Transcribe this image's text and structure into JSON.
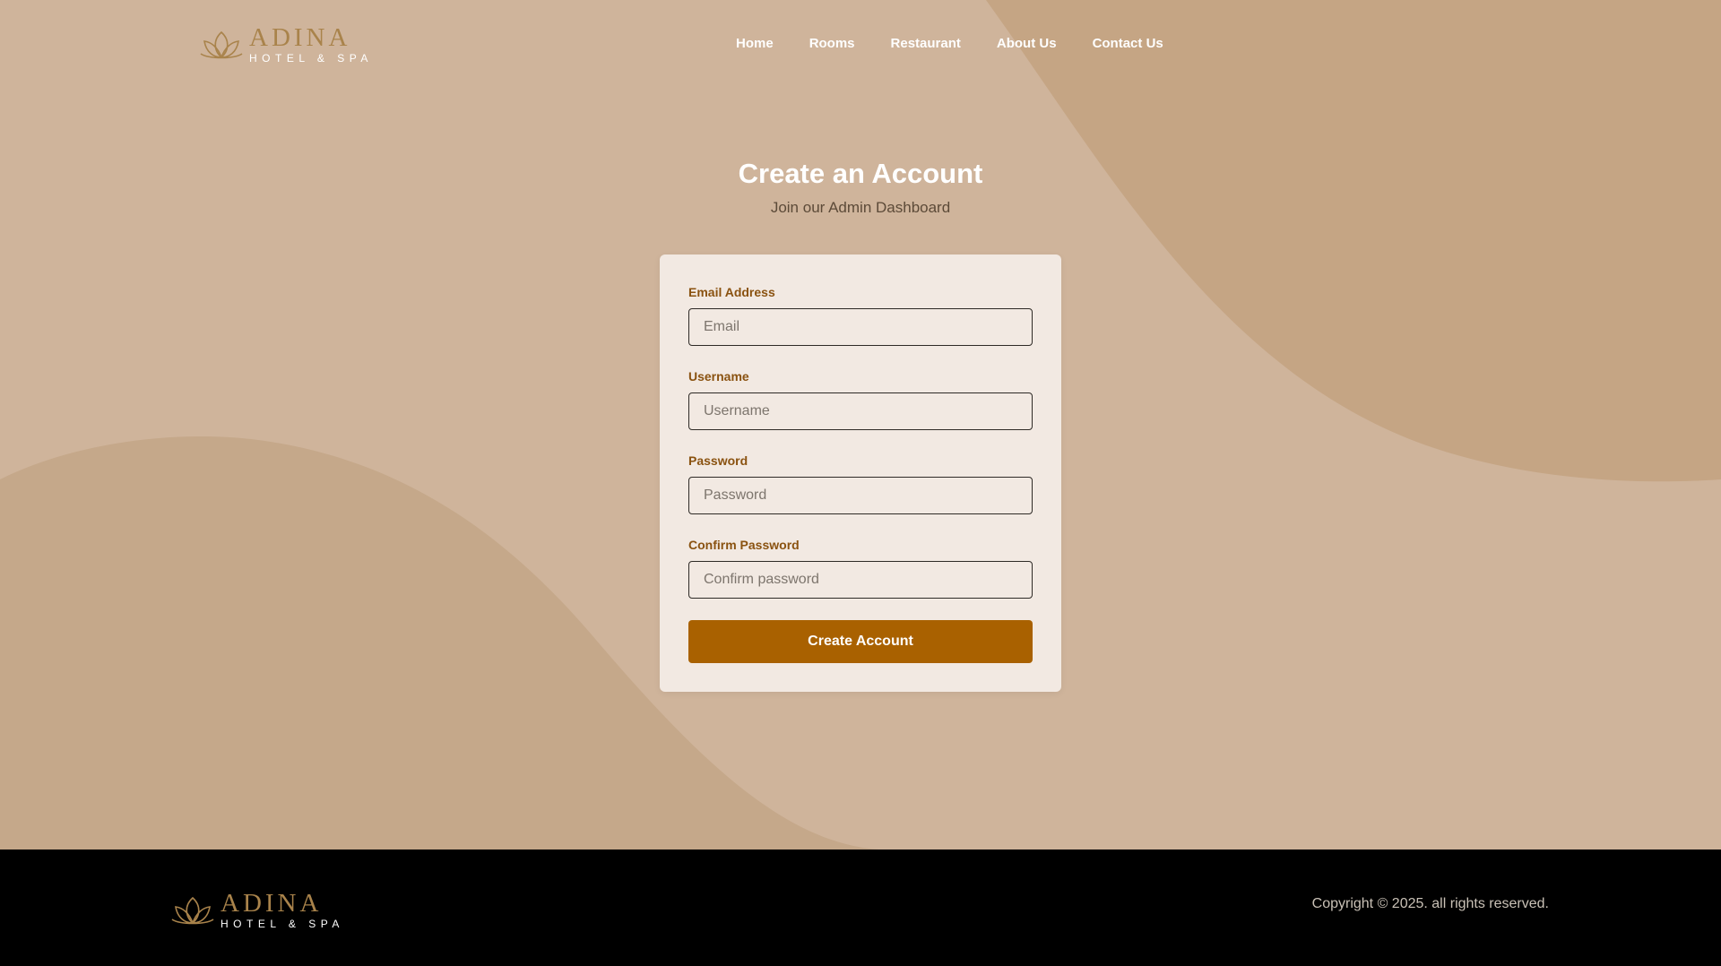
{
  "brand": {
    "name": "ADINA",
    "tagline": "HOTEL & SPA"
  },
  "nav": {
    "items": [
      {
        "label": "Home"
      },
      {
        "label": "Rooms"
      },
      {
        "label": "Restaurant"
      },
      {
        "label": "About Us"
      },
      {
        "label": "Contact Us"
      }
    ]
  },
  "hero": {
    "title": "Create an Account",
    "subtitle": "Join our Admin Dashboard"
  },
  "form": {
    "fields": [
      {
        "label": "Email Address",
        "placeholder": "Email",
        "value": ""
      },
      {
        "label": "Username",
        "placeholder": "Username",
        "value": ""
      },
      {
        "label": "Password",
        "placeholder": "Password",
        "value": ""
      },
      {
        "label": "Confirm Password",
        "placeholder": "Confirm password",
        "value": ""
      }
    ],
    "submit_label": "Create Account"
  },
  "footer": {
    "copyright": "Copyright © 2025. all rights reserved."
  },
  "colors": {
    "background": "#cfb49b",
    "accent": "#a96100",
    "label": "#8a5210",
    "footer": "#000000",
    "logo_gold": "#a9834b"
  },
  "icons": {
    "logo": "lotus-icon"
  }
}
